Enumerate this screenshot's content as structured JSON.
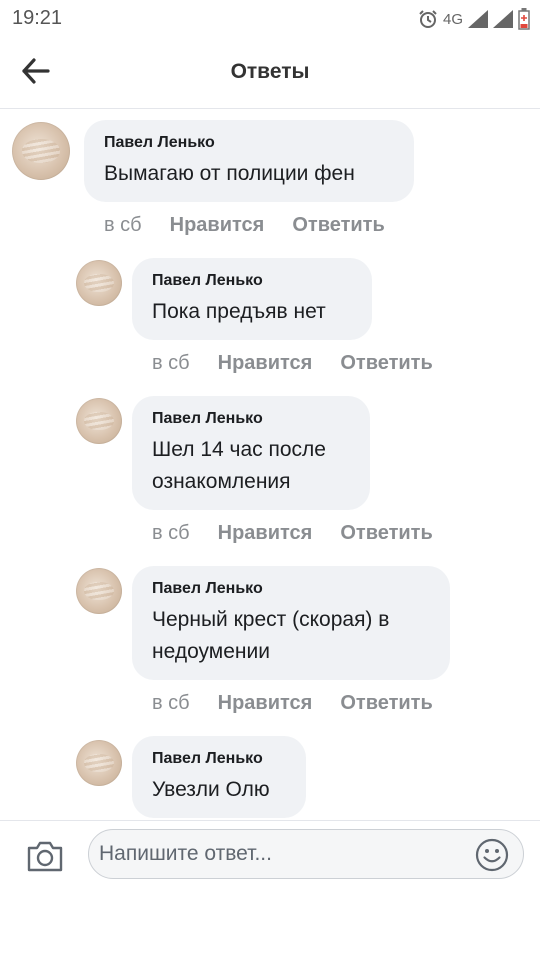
{
  "status_bar": {
    "time": "19:21",
    "network": "4G"
  },
  "header": {
    "title": "Ответы"
  },
  "comments": [
    {
      "author": "Павел Ленько",
      "text": "Вымагаю от полиции фен",
      "time": "в сб",
      "like": "Нравится",
      "reply": "Ответить"
    },
    {
      "author": "Павел Ленько",
      "text": "Пока предъяв нет",
      "time": "в сб",
      "like": "Нравится",
      "reply": "Ответить"
    },
    {
      "author": "Павел Ленько",
      "text_lines": [
        "Шел 14 час после",
        "ознакомления"
      ],
      "time": "в сб",
      "like": "Нравится",
      "reply": "Ответить"
    },
    {
      "author": "Павел Ленько",
      "text_lines": [
        "Черный крест (скорая) в",
        "недоумении"
      ],
      "time": "в сб",
      "like": "Нравится",
      "reply": "Ответить"
    },
    {
      "author": "Павел Ленько",
      "text": "Увезли Олю"
    }
  ],
  "composer": {
    "placeholder": "Напишите ответ..."
  },
  "icons": [
    "alarm-icon",
    "signal-icon",
    "battery-icon",
    "back-arrow-icon",
    "camera-icon",
    "smile-icon"
  ]
}
